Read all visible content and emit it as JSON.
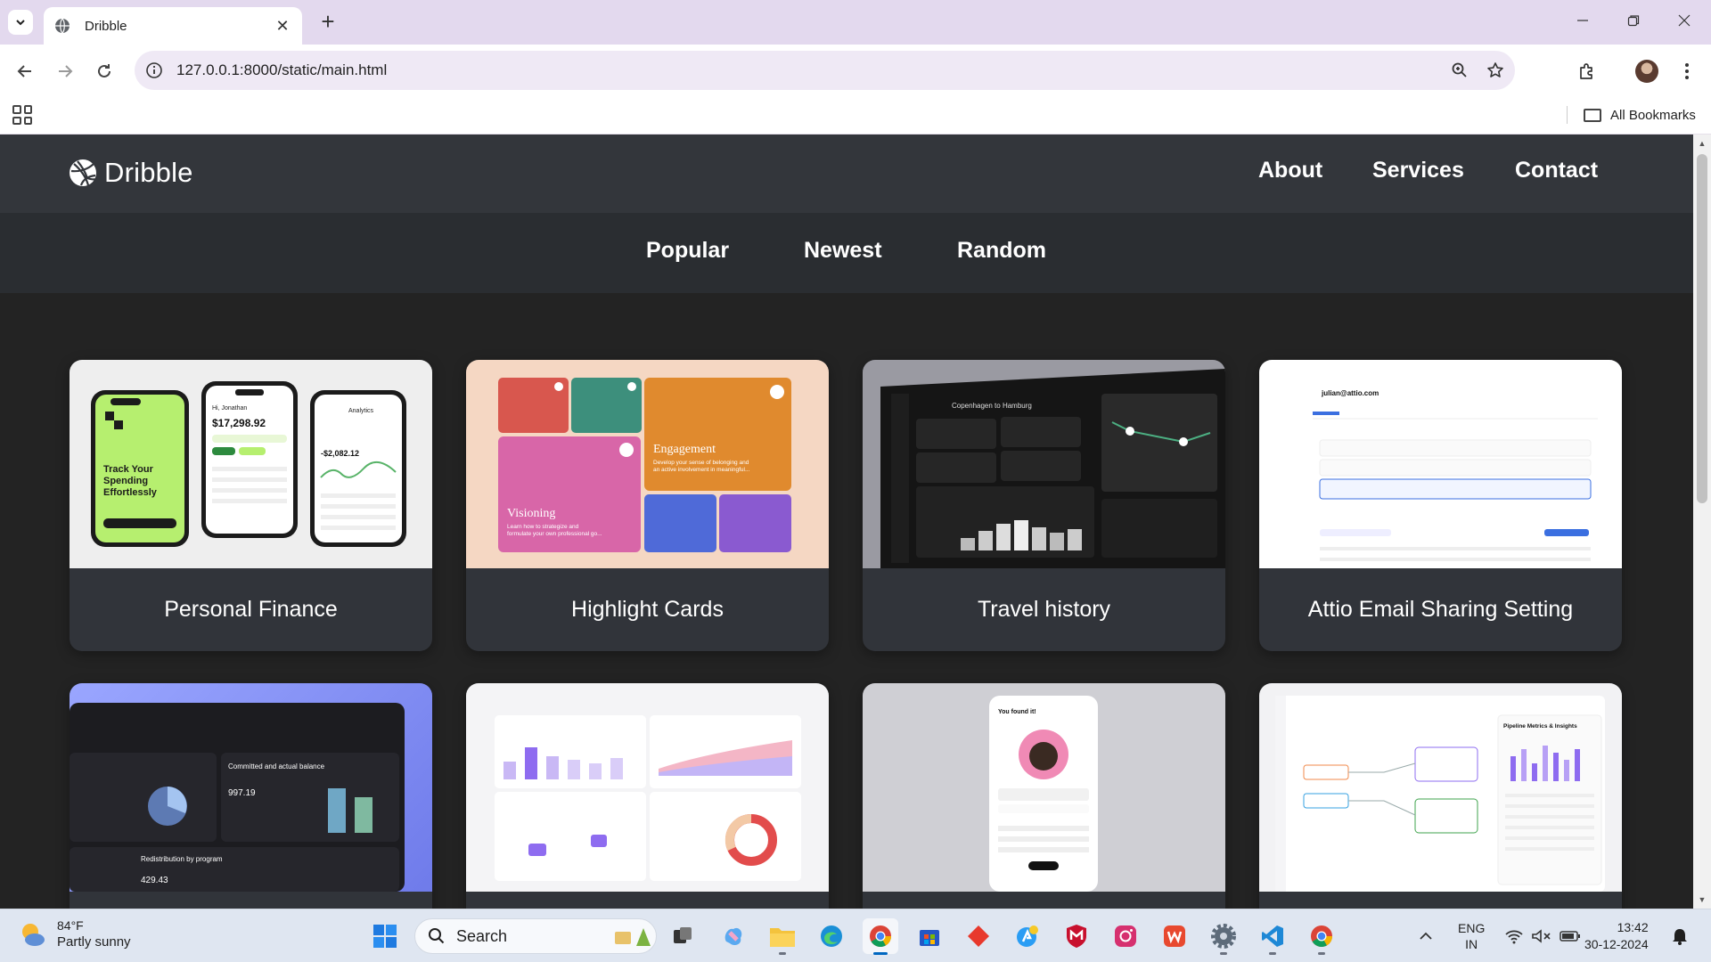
{
  "browser": {
    "tab_title": "Dribble",
    "url": "127.0.0.1:8000/static/main.html",
    "all_bookmarks": "All Bookmarks"
  },
  "site": {
    "logo_text": "Dribble",
    "nav": [
      "About",
      "Services",
      "Contact"
    ],
    "filters": [
      "Popular",
      "Newest",
      "Random"
    ]
  },
  "cards": [
    {
      "title": "Personal Finance"
    },
    {
      "title": "Highlight Cards"
    },
    {
      "title": "Travel history"
    },
    {
      "title": "Attio Email Sharing Setting"
    },
    {
      "title": ""
    },
    {
      "title": ""
    },
    {
      "title": ""
    },
    {
      "title": ""
    }
  ],
  "thumb_text": {
    "finance_headline": "Track Your Spending Effortlessly",
    "finance_greeting": "Hi, Jonathan",
    "finance_balance": "$17,298.92",
    "finance_analytics": "Analytics",
    "finance_amount2": "-$2,082.12",
    "highlight_engagement": "Engagement",
    "highlight_visioning": "Visioning",
    "highlight_engagement_desc": "Develop your sense of belonging and an active involvement in meaningful...",
    "highlight_visioning_desc": "Learn how to strategize and formulate your own professional go...",
    "travel_title": "Copenhagen to Hamburg",
    "attio_email": "julian@attio.com",
    "grant_committed": "Committed and actual balance",
    "grant_value": "997.19",
    "grant_redistribution": "Redistribution by program",
    "grant_value2": "429.43",
    "found_it": "You found it!",
    "pipeline_metrics": "Pipeline Metrics & Insights"
  },
  "taskbar": {
    "temperature": "84°F",
    "weather": "Partly sunny",
    "search_label": "Search",
    "lang1": "ENG",
    "lang2": "IN",
    "time": "13:42",
    "date": "30-12-2024"
  },
  "colors": {
    "page_bg": "#232323",
    "header_bg": "#33363b",
    "card_bg": "#31343a",
    "tabbar_bg": "#e3d9ee"
  }
}
